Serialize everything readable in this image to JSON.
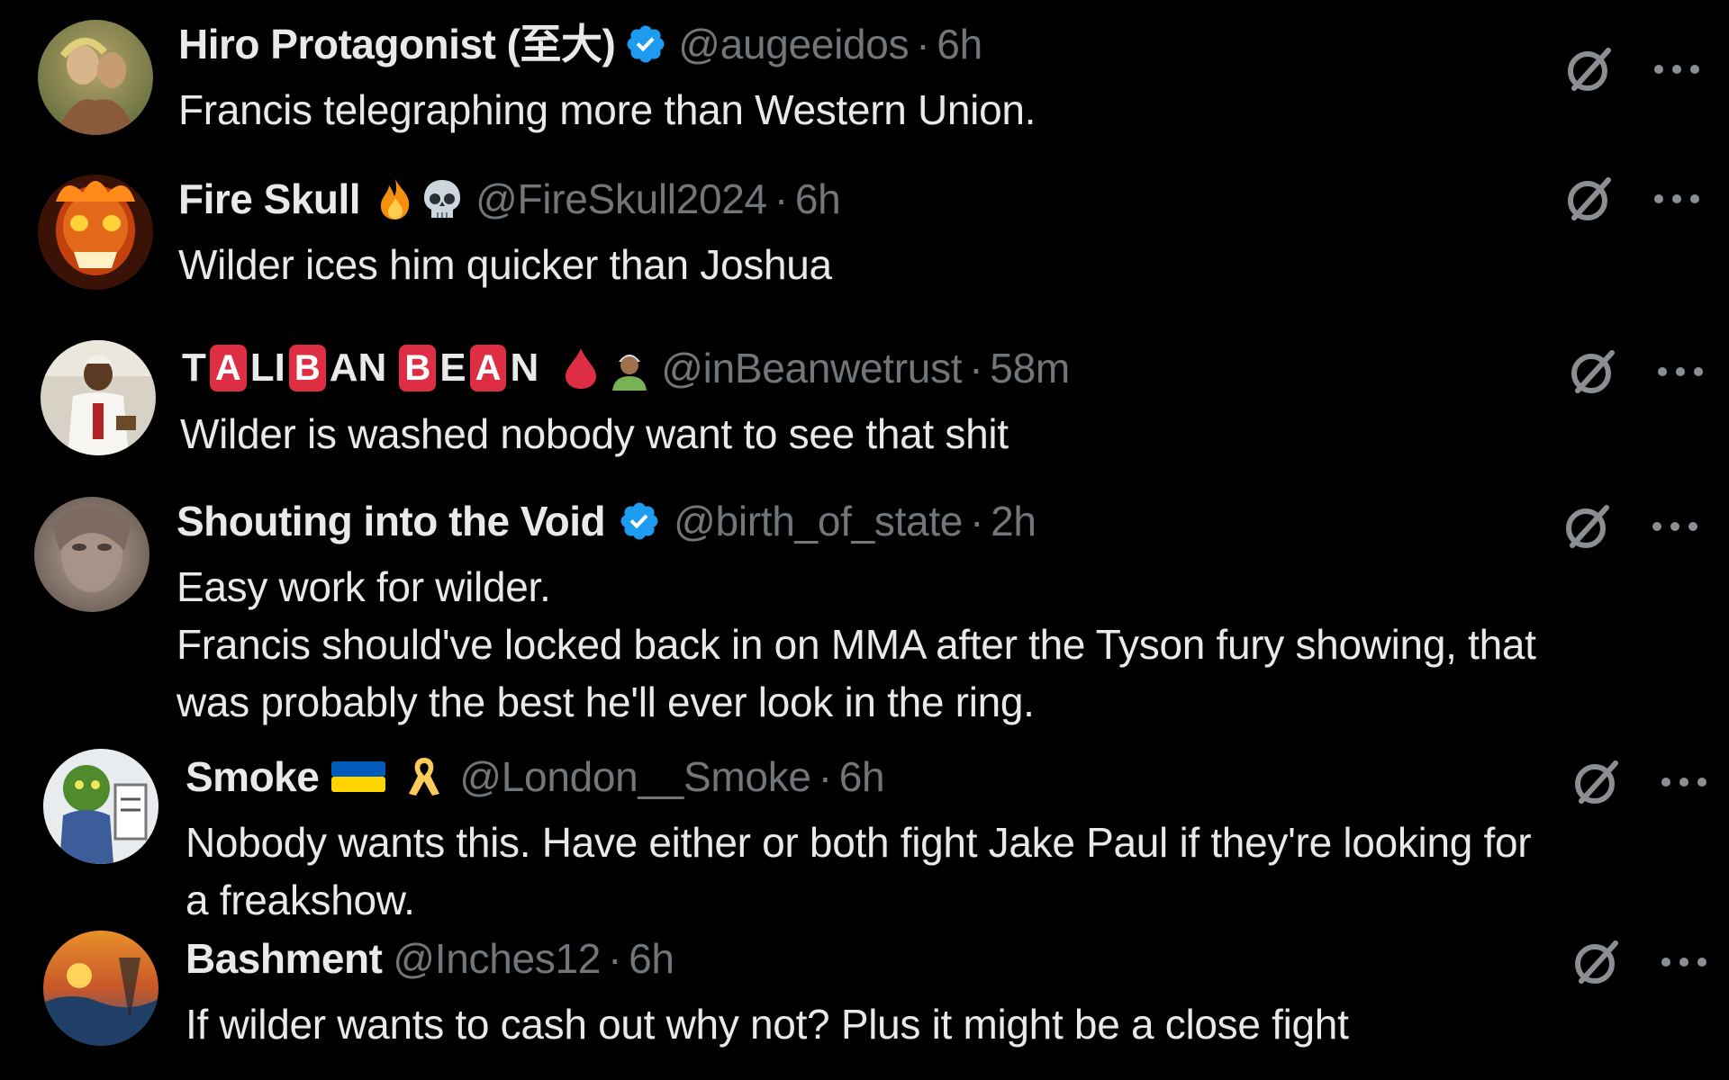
{
  "replies": [
    {
      "name": "Hiro Protagonist (至大)",
      "handle": "@augeeidos",
      "time": "6h",
      "text": [
        "Francis telegraphing more than Western Union."
      ]
    },
    {
      "name": "Fire Skull",
      "handle": "@FireSkull2024",
      "time": "6h",
      "text": [
        "Wilder ices him quicker than Joshua"
      ]
    },
    {
      "name_letters": [
        "T",
        "A",
        "LI",
        "B",
        "AN",
        "B",
        "E",
        "A",
        "N"
      ],
      "handle": "@inBeanwetrust",
      "time": "58m",
      "text": [
        "Wilder is washed nobody want to see that shit"
      ]
    },
    {
      "name": "Shouting into the Void",
      "handle": "@birth_of_state",
      "time": "2h",
      "text": [
        "Easy work for wilder.",
        "Francis should've locked back in on MMA after the Tyson fury showing, that",
        "was probably the best he'll ever look in the ring."
      ]
    },
    {
      "name": "Smoke",
      "handle": "@London__Smoke",
      "time": "6h",
      "text": [
        "Nobody wants this. Have either or both fight Jake Paul if they're looking for",
        "a freakshow."
      ]
    },
    {
      "name": "Bashment",
      "handle": "@Inches12",
      "time": "6h",
      "text": [
        "If wilder wants to cash out why not? Plus it might be a close fight"
      ]
    }
  ],
  "separator": "·",
  "icons": {
    "verified": "verified-badge-icon",
    "grok": "grok-slash-circle-icon",
    "more": "more-dots-icon"
  },
  "colors": {
    "background": "#000000",
    "text": "#e7e9ea",
    "muted": "#71767b",
    "verified": "#1d9bf0",
    "letter_box": "#dd2e44"
  }
}
